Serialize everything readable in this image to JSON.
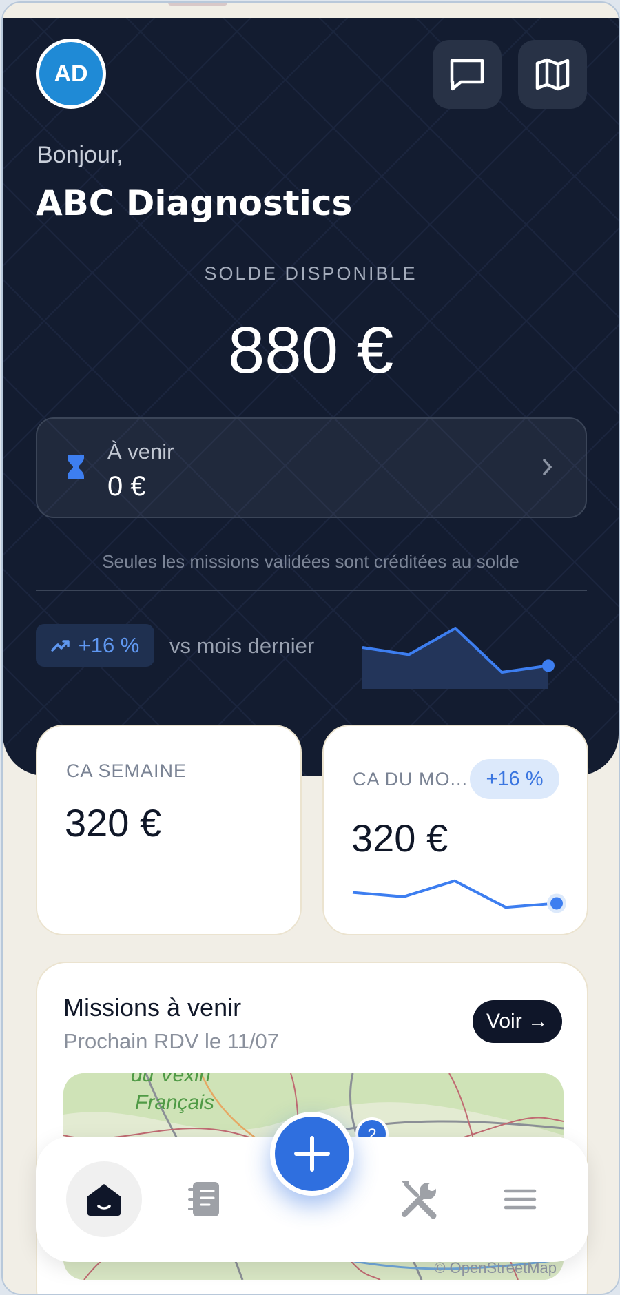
{
  "header": {
    "avatar_initials": "AD",
    "messages_icon": "message-square-icon",
    "map_icon": "map-icon",
    "greeting": "Bonjour,",
    "company": "ABC Diagnostics"
  },
  "balance": {
    "label": "SOLDE DISPONIBLE",
    "amount": "880 €"
  },
  "upcoming": {
    "label": "À venir",
    "amount": "0 €",
    "icon": "hourglass-icon"
  },
  "note": "Seules les missions validées sont créditées au solde",
  "trend": {
    "badge": "+16 %",
    "text": "vs mois dernier",
    "sparkline": [
      0.55,
      0.42,
      0.9,
      0.1,
      0.22
    ]
  },
  "stats": {
    "week_label": "CA SEMAINE",
    "week_value": "320 €",
    "month_label": "CA DU MO...",
    "month_badge": "+16 %",
    "month_value": "320 €",
    "month_sparkline": [
      0.55,
      0.42,
      0.9,
      0.1,
      0.22
    ]
  },
  "missions": {
    "title": "Missions à venir",
    "subtitle": "Prochain RDV le 11/07",
    "voir_label": "Voir →",
    "map_label_1": "du Vexin",
    "map_label_2": "Français",
    "map_marker": "2",
    "map_attribution": "© OpenStreetMap"
  },
  "nav": {
    "items": [
      "home-icon",
      "notebook-icon",
      "plus-icon",
      "tools-icon",
      "menu-icon"
    ]
  },
  "colors": {
    "hero_bg": "#131c30",
    "accent": "#2f6fdf",
    "page_bg": "#f1eee6"
  }
}
